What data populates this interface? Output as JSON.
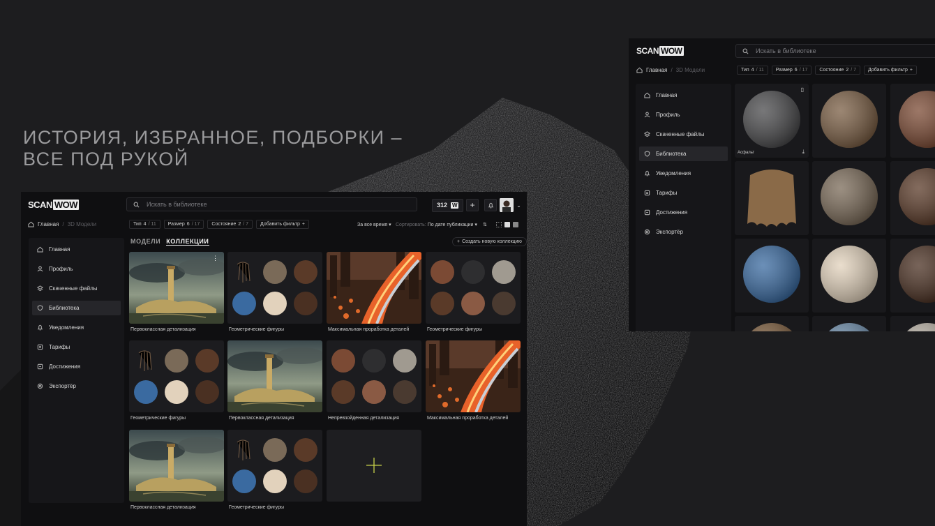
{
  "headline": [
    "ИСТОРИЯ, ИЗБРАННОЕ, ПОДБОРКИ –",
    "ВСЕ ПОД РУКОЙ"
  ],
  "app": {
    "logo_left": "SCAN",
    "logo_right": "WOW",
    "search_placeholder": "Искать в библиотеке",
    "coins": "312",
    "breadcrumb": {
      "home": "Главная",
      "separator": "/",
      "current": "3D Модели"
    },
    "filters": [
      {
        "label": "Тип",
        "value": "4",
        "total": "/ 11"
      },
      {
        "label": "Размер",
        "value": "6",
        "total": "/ 17"
      },
      {
        "label": "Состояние",
        "value": "2",
        "total": "/ 7"
      }
    ],
    "add_filter": "Добавить фильтр",
    "period": "За все время",
    "sort_label": "Сортировать:",
    "sort_value": "По дате публикации",
    "nav": [
      {
        "label": "Главная",
        "icon": "home-icon"
      },
      {
        "label": "Профиль",
        "icon": "user-icon"
      },
      {
        "label": "Скаченные файлы",
        "icon": "layers-icon"
      },
      {
        "label": "Библиотека",
        "icon": "shield-icon"
      },
      {
        "label": "Уведомления",
        "icon": "bell-icon"
      },
      {
        "label": "Тарифы",
        "icon": "tag-icon"
      },
      {
        "label": "Достижения",
        "icon": "award-icon"
      },
      {
        "label": "Экспортёр",
        "icon": "gear-icon"
      }
    ],
    "tabs": [
      "МОДЕЛИ",
      "КОЛЛЕКЦИИ"
    ],
    "active_tab": "КОЛЛЕКЦИИ",
    "active_nav": "Библиотека",
    "new_collection": "Создать новую коллекцию",
    "collections": [
      {
        "title": "Первоклассная детализация",
        "art": "tower"
      },
      {
        "title": "Геометрические фигуры",
        "art": "spheres-a"
      },
      {
        "title": "Максимальная проработка деталей",
        "art": "city"
      },
      {
        "title": "Геометрические фигуры",
        "art": "spheres-b"
      },
      {
        "title": "Геометрические фигуры",
        "art": "spheres-a"
      },
      {
        "title": "Первоклассная детализация",
        "art": "tower"
      },
      {
        "title": "Непревзойденная детализация",
        "art": "spheres-b"
      },
      {
        "title": "Максимальная проработка деталей",
        "art": "city"
      },
      {
        "title": "Первоклассная детализация",
        "art": "tower"
      },
      {
        "title": "Геометрические фигуры",
        "art": "spheres-a"
      }
    ],
    "back_window": {
      "nav": [
        "Главная",
        "Профиль",
        "Скаченные файлы",
        "Библиотека",
        "Уведомления",
        "Тарифы",
        "Достижения",
        "Экспортёр"
      ],
      "first_material_label": "Асфальт",
      "materials": [
        "#4a4a4c",
        "#7a5e44",
        "#7b4a34",
        "#8a6a48",
        "#7a6a58",
        "#5a3a28",
        "#3a6aa0",
        "#e2d2bc",
        "#4a3022",
        "#7a5a3a",
        "#6a8aa8",
        "#b8b0a4"
      ]
    }
  }
}
